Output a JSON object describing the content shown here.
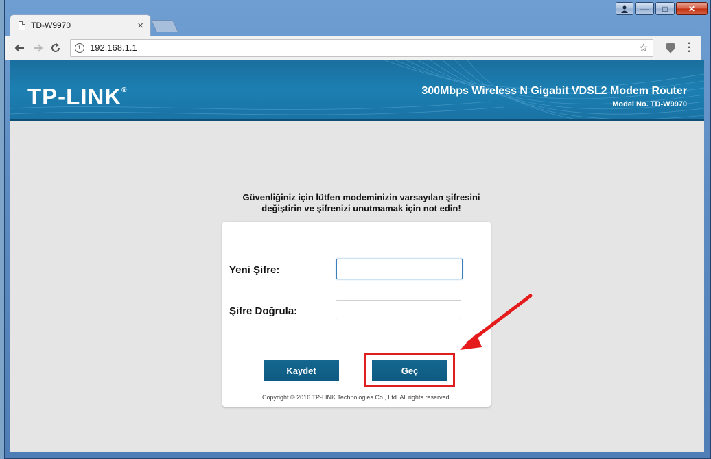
{
  "browser": {
    "tab_title": "TD-W9970",
    "tab_close": "×",
    "url": "192.168.1.1",
    "window_controls": {
      "minimize": "—",
      "maximize": "□",
      "close": "✕"
    }
  },
  "header": {
    "brand": "TP-LINK",
    "trademark": "®",
    "product": "300Mbps Wireless N Gigabit VDSL2 Modem Router",
    "model": "Model No. TD-W9970"
  },
  "notice": {
    "line1": "Güvenliğiniz için lütfen modeminizin varsayılan şifresini",
    "line2": "değiştirin ve şifrenizi unutmamak için not edin!"
  },
  "form": {
    "new_password_label": "Yeni Şifre:",
    "new_password_value": "",
    "confirm_password_label": "Şifre Doğrula:",
    "confirm_password_value": "",
    "save_label": "Kaydet",
    "skip_label": "Geç"
  },
  "footer": {
    "copyright": "Copyright © 2016 TP-LINK Technologies Co., Ltd. All rights reserved."
  },
  "colors": {
    "header_blue": "#1c7fb2",
    "button_blue": "#0d5a82",
    "highlight_red": "#e01e1e"
  },
  "icons": [
    "page-icon",
    "back-icon",
    "forward-icon",
    "reload-icon",
    "info-icon",
    "star-icon",
    "shield-icon",
    "menu-icon",
    "user-icon"
  ]
}
